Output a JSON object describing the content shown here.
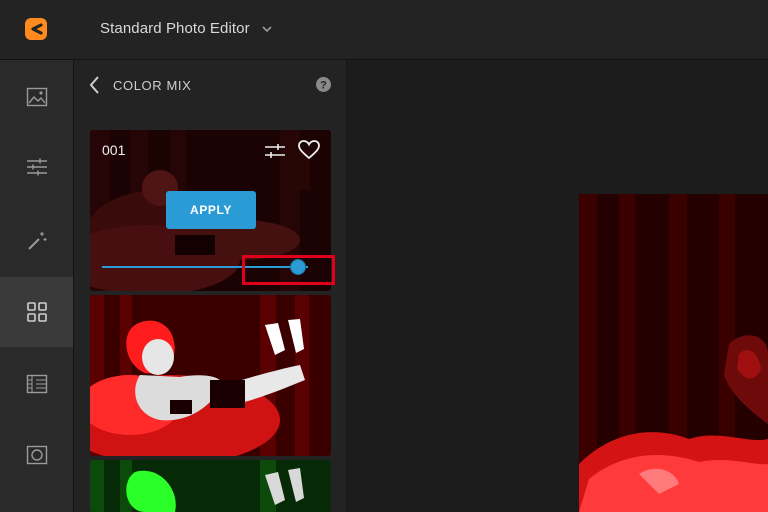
{
  "header": {
    "app_title": "Standard Photo Editor",
    "logo_icon": "app-logo-icon",
    "dropdown_icon": "chevron-down-icon"
  },
  "left_rail": {
    "items": [
      {
        "name": "image-icon",
        "active": false
      },
      {
        "name": "sliders-icon",
        "active": false
      },
      {
        "name": "magic-wand-icon",
        "active": false
      },
      {
        "name": "grid-icon",
        "active": true
      },
      {
        "name": "film-icon",
        "active": false
      },
      {
        "name": "vignette-icon",
        "active": false
      }
    ]
  },
  "panel": {
    "title": "COLOR MIX",
    "back_icon": "chevron-left-icon",
    "help_icon": "help-icon",
    "cards": [
      {
        "label": "001",
        "apply_label": "APPLY",
        "intensity": 0.95,
        "tint": "#ff2a2a"
      },
      {
        "label": "",
        "tint": "#ff2a2a"
      },
      {
        "label": "",
        "tint": "#2aff2a"
      }
    ]
  },
  "colors": {
    "accent": "#2a9bd4",
    "highlight": "#e0001c"
  }
}
